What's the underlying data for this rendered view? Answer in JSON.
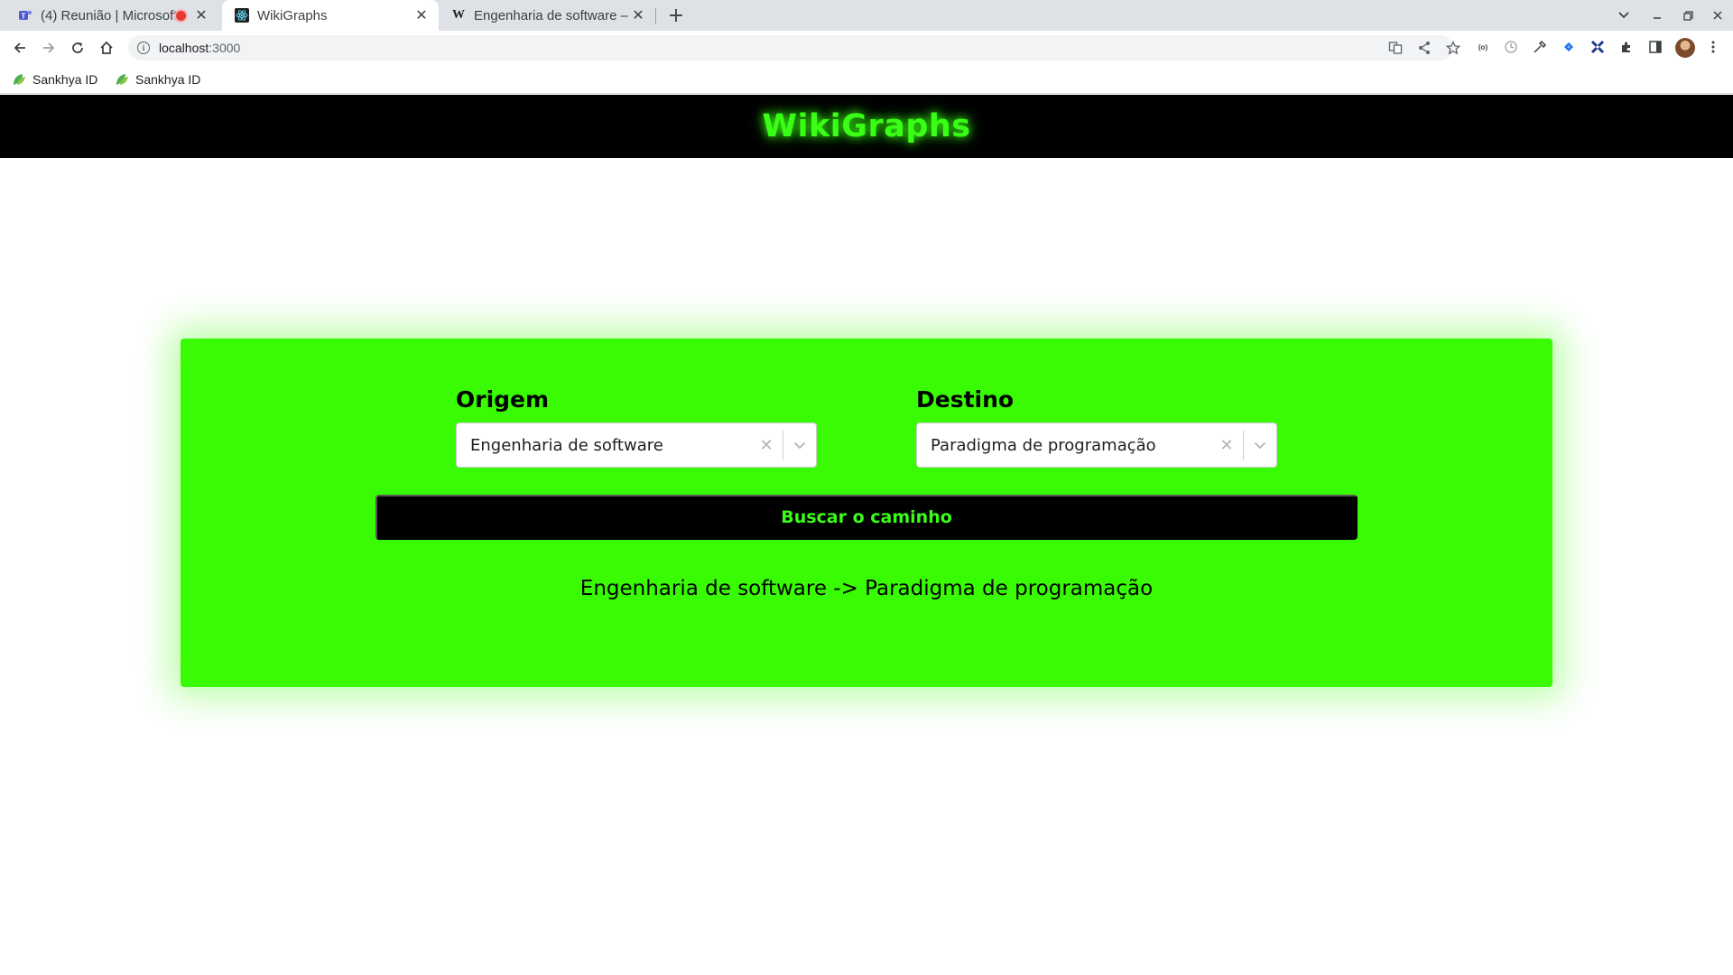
{
  "browser": {
    "tabs": [
      {
        "title": "(4) Reunião | Microsoft",
        "icon": "teams-icon",
        "recording": true
      },
      {
        "title": "WikiGraphs",
        "icon": "react-icon",
        "active": true
      },
      {
        "title": "Engenharia de software –",
        "icon": "wikipedia-icon"
      }
    ],
    "address": {
      "host": "localhost",
      "port": ":3000"
    },
    "bookmarks": [
      "Sankhya ID",
      "Sankhya ID"
    ],
    "accent": "#39ff14"
  },
  "app": {
    "title": "WikiGraphs",
    "origin": {
      "label": "Origem",
      "value": "Engenharia de software"
    },
    "destination": {
      "label": "Destino",
      "value": "Paradigma de programação"
    },
    "search_button": "Buscar o caminho",
    "result": "Engenharia de software -> Paradigma de programação",
    "colors": {
      "card": "#39fc04",
      "header": "#000000",
      "title": "#39ff14"
    }
  }
}
